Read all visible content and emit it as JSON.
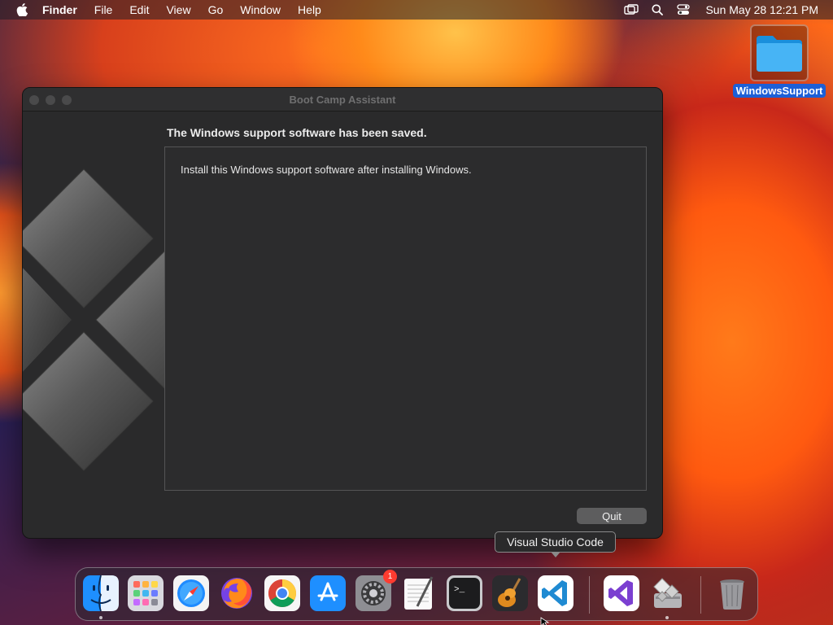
{
  "menubar": {
    "app_name": "Finder",
    "items": [
      "File",
      "Edit",
      "View",
      "Go",
      "Window",
      "Help"
    ],
    "clock": "Sun May 28  12:21 PM"
  },
  "desktop": {
    "folder_label": "WindowsSupport"
  },
  "window": {
    "title": "Boot Camp Assistant",
    "heading": "The Windows support software has been saved.",
    "body": "Install this Windows support software after installing Windows.",
    "quit_label": "Quit"
  },
  "tooltip": {
    "text": "Visual Studio Code"
  },
  "dock": {
    "items": [
      {
        "icon": "finder-icon",
        "running": true
      },
      {
        "icon": "launchpad-icon",
        "running": false
      },
      {
        "icon": "safari-icon",
        "running": false
      },
      {
        "icon": "firefox-icon",
        "running": false
      },
      {
        "icon": "chrome-icon",
        "running": false
      },
      {
        "icon": "app-store-icon",
        "running": false
      },
      {
        "icon": "system-settings-icon",
        "running": false,
        "badge": "1"
      },
      {
        "icon": "textedit-icon",
        "running": false
      },
      {
        "icon": "terminal-icon",
        "running": false
      },
      {
        "icon": "garageband-icon",
        "running": false
      },
      {
        "icon": "vscode-icon",
        "running": false
      },
      {
        "icon": "visual-studio-icon",
        "running": false
      },
      {
        "icon": "boot-camp-assistant-icon",
        "running": true
      },
      {
        "icon": "trash-icon",
        "running": false
      }
    ],
    "settings_badge": "1",
    "terminal_prompt": ">_"
  },
  "colors": {
    "window_bg": "#2a2a2b",
    "selection_blue": "#1d5fd6",
    "badge_red": "#ff3b30"
  }
}
